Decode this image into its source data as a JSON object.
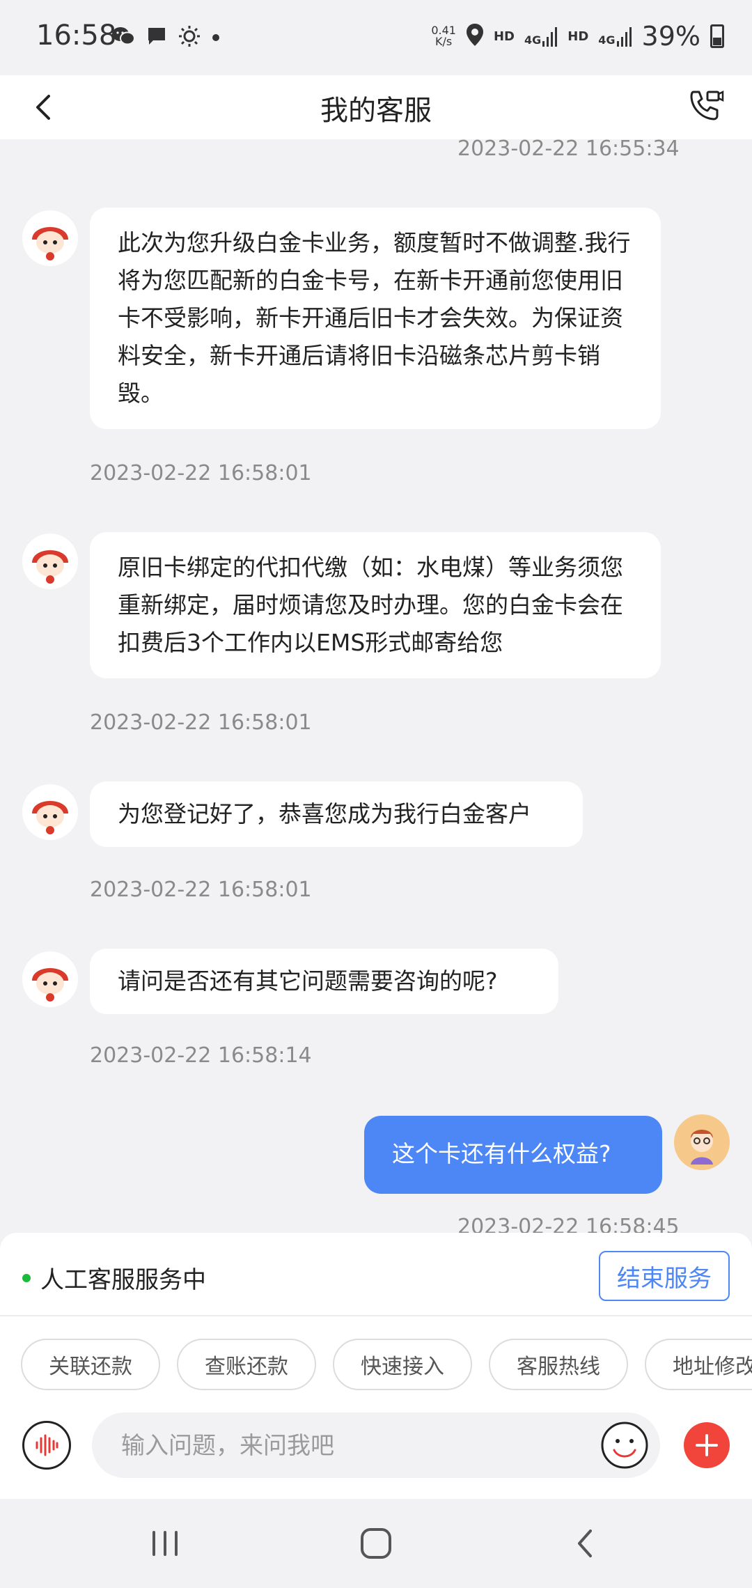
{
  "status_bar": {
    "time": "16:58",
    "net_speed_value": "0.41",
    "net_speed_unit": "K/s",
    "hd1": "HD",
    "net1": "4G",
    "hd2": "HD",
    "net2": "4G",
    "battery": "39%",
    "icons": [
      "wechat-icon",
      "message-icon",
      "brightness-icon",
      "dot-icon",
      "location-icon",
      "signal-icon",
      "battery-icon"
    ]
  },
  "header": {
    "title": "我的客服"
  },
  "chat": {
    "top_timestamp": "2023-02-22 16:55:34",
    "messages": [
      {
        "sender": "agent",
        "text": "此次为您升级白金卡业务，额度暂时不做调整.我行将为您匹配新的白金卡号，在新卡开通前您使用旧卡不受影响，新卡开通后旧卡才会失效。为保证资料安全，新卡开通后请将旧卡沿磁条芯片剪卡销毁。",
        "time": "2023-02-22 16:58:01"
      },
      {
        "sender": "agent",
        "text": "原旧卡绑定的代扣代缴（如：水电煤）等业务须您重新绑定，届时烦请您及时办理。您的白金卡会在扣费后3个工作内以EMS形式邮寄给您",
        "time": "2023-02-22 16:58:01"
      },
      {
        "sender": "agent",
        "text": "为您登记好了，恭喜您成为我行白金客户",
        "time": "2023-02-22 16:58:01"
      },
      {
        "sender": "agent",
        "text": "请问是否还有其它问题需要咨询的呢?",
        "time": "2023-02-22 16:58:14"
      },
      {
        "sender": "user",
        "text": "这个卡还有什么权益?",
        "time": "2023-02-22 16:58:45"
      }
    ]
  },
  "service_panel": {
    "status_text": "人工客服服务中",
    "end_button": "结束服务",
    "status_color": "#1db93a",
    "accent_color": "#4d86f5"
  },
  "quick_actions": [
    "关联还款",
    "查账还款",
    "快速接入",
    "客服热线",
    "地址修改"
  ],
  "input": {
    "placeholder": "输入问题，来问我吧"
  },
  "colors": {
    "user_bubble": "#4d86f5",
    "plus_button": "#f1443a"
  }
}
